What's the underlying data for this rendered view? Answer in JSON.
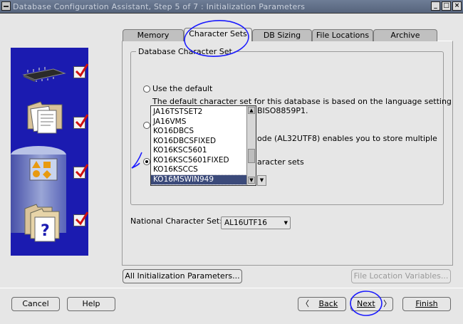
{
  "window": {
    "title": "Database Configuration Assistant, Step 5 of 7 : Initialization Parameters",
    "controls": [
      "_",
      "□",
      "×"
    ]
  },
  "left_panel": {
    "steps": [
      {
        "icon": "memory-chip-icon",
        "checked": true
      },
      {
        "icon": "documents-icon",
        "checked": true
      },
      {
        "icon": "shapes-icon",
        "checked": true
      },
      {
        "icon": "folders-help-icon",
        "checked": true
      }
    ]
  },
  "tabs": [
    {
      "label": "Memory",
      "active": false
    },
    {
      "label": "Character Sets",
      "active": true
    },
    {
      "label": "DB Sizing",
      "active": false
    },
    {
      "label": "File Locations",
      "active": false
    },
    {
      "label": "Archive",
      "active": false
    }
  ],
  "character_sets": {
    "group_label": "Database Character Set",
    "use_default_label": "Use the default",
    "default_desc_line1": "The default character set for this database is based on the language setting",
    "default_desc_line2_suffix": "BISO8859P1.",
    "unicode_desc_suffix": "ode (AL32UTF8) enables you to store multiple",
    "choose_label_suffix": "aracter sets",
    "list_items": [
      "JA16TSTSET2",
      "JA16VMS",
      "KO16DBCS",
      "KO16DBCSFIXED",
      "KO16KSC5601",
      "KO16KSC5601FIXED",
      "KO16KSCCS",
      "KO16MSWIN949"
    ],
    "selected_item": "KO16MSWIN949",
    "national_label": "National Character Set:",
    "national_value": "AL16UTF16"
  },
  "buttons": {
    "all_params": "All Initialization Parameters...",
    "file_location_vars": "File Location Variables...",
    "cancel": "Cancel",
    "help": "Help",
    "back": "Back",
    "next": "Next",
    "finish": "Finish"
  },
  "colors": {
    "titlebar": "#5e6c86",
    "left_panel": "#1b1bb0",
    "selection": "#3b4a7a",
    "annotation_ink": "#1a1aff"
  }
}
